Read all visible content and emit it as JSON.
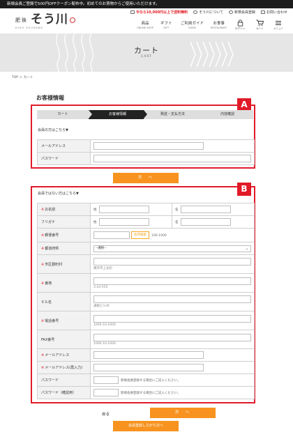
{
  "topbar": {
    "notice": "新規会員ご登録で500円OFFクーポン配布中。初めてのお買物からご使用いただけます。"
  },
  "header": {
    "logo_pre": "肥後",
    "logo_main": "そう川",
    "logo_sub": "HIGO SOUKAWA",
    "links": [
      {
        "label": "今なら10,000円以上で送料無料",
        "icon": "truck-icon"
      },
      {
        "label": "そう川について",
        "icon": "info-icon"
      },
      {
        "label": "新規会員登録",
        "icon": "user-icon"
      },
      {
        "label": "お問い合わせ",
        "icon": "mail-icon"
      }
    ],
    "nav": [
      {
        "label": "商品",
        "en": "ONLINE SHOP"
      },
      {
        "label": "ギフト",
        "en": "GIFT"
      },
      {
        "label": "ご利用ガイド",
        "en": "GUIDE"
      },
      {
        "label": "お食事",
        "en": "RESTAURANT"
      }
    ],
    "icons": [
      {
        "label": "ログイン",
        "icon": "lock-icon"
      },
      {
        "label": "カート",
        "icon": "cart-icon"
      },
      {
        "label": "メニュー",
        "icon": "menu-icon"
      }
    ]
  },
  "banner": {
    "title": "カート",
    "subtitle": "CART"
  },
  "breadcrumb": {
    "home": "TOP",
    "sep": ">",
    "current": "カート"
  },
  "section_title": "お客様情報",
  "annotations": {
    "a": "A",
    "b": "B"
  },
  "steps": [
    "カート",
    "お客様情報",
    "発送・支払方法",
    "内容確認"
  ],
  "members": {
    "heading": "会員の方はこちら▼",
    "email_label": "メールアドレス",
    "password_label": "パスワード"
  },
  "next_button": "次　へ",
  "guest": {
    "heading": "会員ではない方はこちら▼",
    "req_mark": "※",
    "name_label": "お名前",
    "kana_label": "フリガナ",
    "sei": "姓",
    "mei": "名",
    "zip_label": "郵便番号",
    "zip_button": "住所検索",
    "zip_hint": "100-1000",
    "pref_label": "都道府県",
    "pref_value": "--選択--",
    "city_label": "市区郡町村",
    "city_hint": "横浜市上北町",
    "addr_label": "番地",
    "addr_hint": "3-24-555",
    "bldg_label": "ビル名",
    "bldg_hint": "通販ビル4F",
    "tel_label": "電話番号",
    "tel_hint": "1000-10-1000",
    "fax_label": "FAX番号",
    "fax_hint": "1000-10-1000",
    "email_label": "メールアドレス",
    "email2_label": "メールアドレス(再入力)",
    "pass_label": "パスワード",
    "pass_note": "新規会員登録する場合にご記入ください。",
    "pass2_label": "パスワード（確認用）",
    "pass2_note": "新規会員登録する場合にご記入ください。"
  },
  "footer": {
    "back": "戻る",
    "next": "次　へ",
    "register": "会員登録しながら次へ"
  },
  "colors": {
    "accent": "#f7931e",
    "highlight": "#e11a28",
    "required": "#e31b23"
  }
}
